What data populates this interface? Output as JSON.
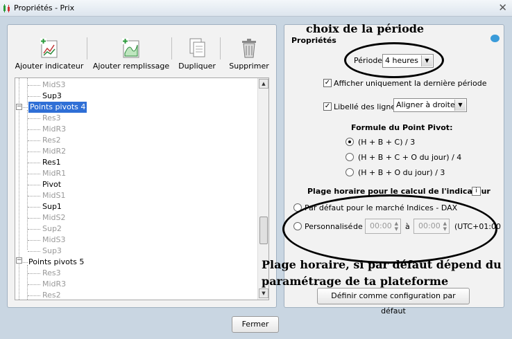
{
  "window": {
    "title": "Propriétés - Prix",
    "close_glyph": "✕"
  },
  "toolbar": {
    "add_indicator": "Ajouter indicateur",
    "add_fill": "Ajouter remplissage",
    "duplicate": "Dupliquer",
    "delete": "Supprimer"
  },
  "tree": {
    "items": [
      {
        "label": "MidS3",
        "state": "gray"
      },
      {
        "label": "Sup3",
        "state": "normal"
      },
      {
        "label": "Points pivots 4",
        "state": "selected"
      },
      {
        "label": "Res3",
        "state": "gray"
      },
      {
        "label": "MidR3",
        "state": "gray"
      },
      {
        "label": "Res2",
        "state": "gray"
      },
      {
        "label": "MidR2",
        "state": "gray"
      },
      {
        "label": "Res1",
        "state": "normal"
      },
      {
        "label": "MidR1",
        "state": "gray"
      },
      {
        "label": "Pivot",
        "state": "normal"
      },
      {
        "label": "MidS1",
        "state": "gray"
      },
      {
        "label": "Sup1",
        "state": "normal"
      },
      {
        "label": "MidS2",
        "state": "gray"
      },
      {
        "label": "Sup2",
        "state": "gray"
      },
      {
        "label": "MidS3",
        "state": "gray"
      },
      {
        "label": "Sup3",
        "state": "gray"
      },
      {
        "label": "Points pivots 5",
        "state": "normal"
      },
      {
        "label": "Res3",
        "state": "gray"
      },
      {
        "label": "MidR3",
        "state": "gray"
      },
      {
        "label": "Res2",
        "state": "gray"
      }
    ]
  },
  "properties": {
    "heading": "Propriétés",
    "period_label": "Période",
    "period_value": "4 heures",
    "last_period_only": "Afficher uniquement la dernière période",
    "line_labels": "Libellé des lignes",
    "line_labels_value": "Aligner à droite",
    "formula_title": "Formule du Point Pivot:",
    "formula_options": [
      "(H + B + C) / 3",
      "(H + B + C + O du jour) / 4",
      "(H + B + O du jour) / 3"
    ],
    "range_title": "Plage horaire pour le calcul de l'indicateur",
    "default_market": "Par défaut pour le marché Indices - DAX",
    "custom": "Personnalisé",
    "from": "de",
    "from_time": "00:00",
    "to": "à",
    "to_time": "00:00",
    "timezone": "(UTC+01:00",
    "set_default": "Définir comme configuration par défaut"
  },
  "footer": {
    "close": "Fermer"
  },
  "annotations": {
    "period": "choix de la période",
    "range_line1": "Plage horaire, si par défaut dépend du",
    "range_line2": "paramétrage de ta plateforme"
  }
}
